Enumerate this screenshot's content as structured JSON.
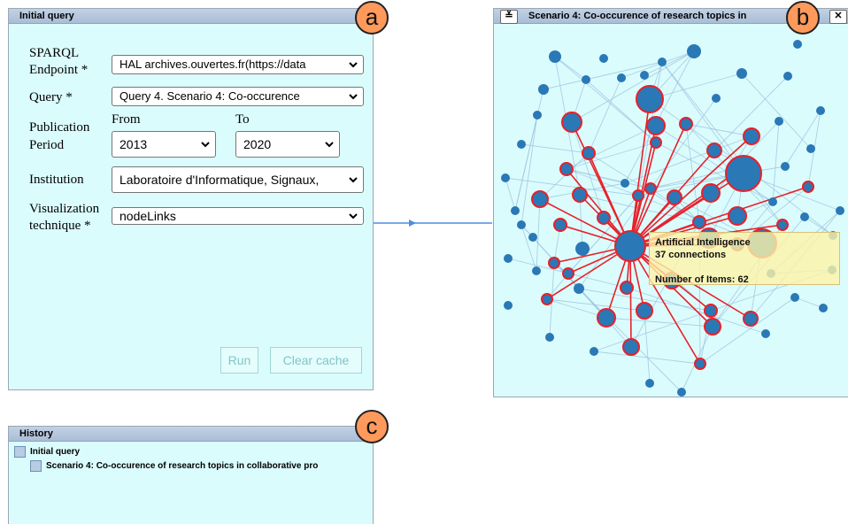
{
  "query_panel": {
    "title": "Initial query",
    "badge": "a",
    "endpoint_label_1": "SPARQL",
    "endpoint_label_2": "Endpoint *",
    "endpoint_value": "HAL archives.ouvertes.fr(https://data",
    "query_label": "Query *",
    "query_value": "Query 4. Scenario 4: Co-occurence",
    "period_label_1": "Publication",
    "period_label_2": "Period",
    "from_label": "From",
    "to_label": "To",
    "from_value": "2013",
    "to_value": "2020",
    "institution_label": "Institution",
    "institution_value": "Laboratoire d'Informatique, Signaux,",
    "viz_label_1": "Visualization",
    "viz_label_2": "technique *",
    "viz_value": "nodeLinks",
    "run_label": "Run",
    "clear_label": "Clear cache"
  },
  "viz_panel": {
    "title": "Scenario 4: Co-occurence of research topics in",
    "badge": "b",
    "collapse_icon": "≚",
    "close_icon": "✕",
    "tooltip": {
      "topic": "Artificial Intelligence",
      "connections": "37 connections",
      "items": "Number of Items: 62"
    }
  },
  "history_panel": {
    "title": "History",
    "badge": "c",
    "items": [
      "Initial query",
      "Scenario 4: Co-occurence of research topics in collaborative pro"
    ]
  },
  "colors": {
    "panel_bg": "#dbfcfd",
    "node": "#2a78b6",
    "highlight": "#e8202a",
    "edge": "#9ec4df",
    "badge": "#ff9a5c"
  }
}
